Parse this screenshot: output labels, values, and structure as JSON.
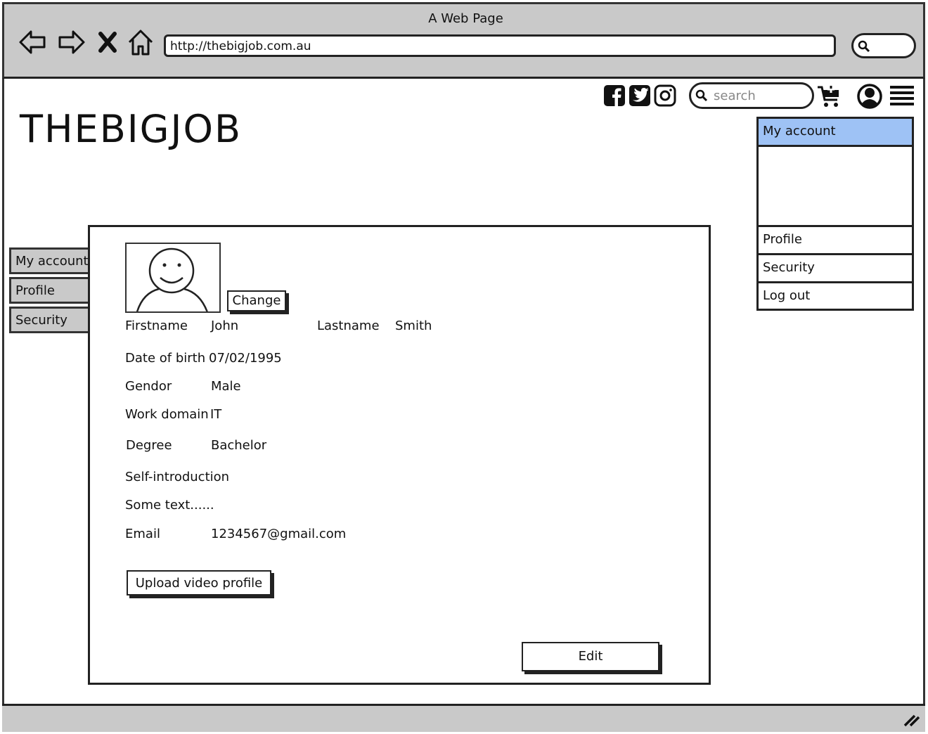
{
  "window": {
    "title": "A Web Page",
    "url": "http://thebigjob.com.au"
  },
  "header": {
    "logo": "THEBIGJOB",
    "search_placeholder": "search"
  },
  "account_menu": {
    "items": [
      "My account",
      "Profile",
      "Security",
      "Log out"
    ]
  },
  "side_tabs": [
    "My account",
    "Profile",
    "Security"
  ],
  "profile": {
    "change_label": "Change",
    "firstname_label": "Firstname",
    "firstname": "John",
    "lastname_label": "Lastname",
    "lastname": "Smith",
    "dob_label": "Date of birth",
    "dob": "07/02/1995",
    "gender_label": "Gendor",
    "gender": "Male",
    "domain_label": "Work domain",
    "domain": "IT",
    "degree_label": "Degree",
    "degree": "Bachelor",
    "intro_label": "Self-introduction",
    "intro_text": "Some text......",
    "email_label": "Email",
    "email": "1234567@gmail.com",
    "upload_label": "Upload video profile",
    "edit_label": "Edit"
  },
  "colors": {
    "chrome": "#c9c9c9",
    "highlight": "#9ec2f5"
  },
  "icons": [
    "back-icon",
    "forward-icon",
    "close-icon",
    "home-icon",
    "search-icon",
    "facebook-icon",
    "twitter-icon",
    "instagram-icon",
    "cart-icon",
    "user-icon",
    "menu-icon",
    "resize-icon"
  ]
}
